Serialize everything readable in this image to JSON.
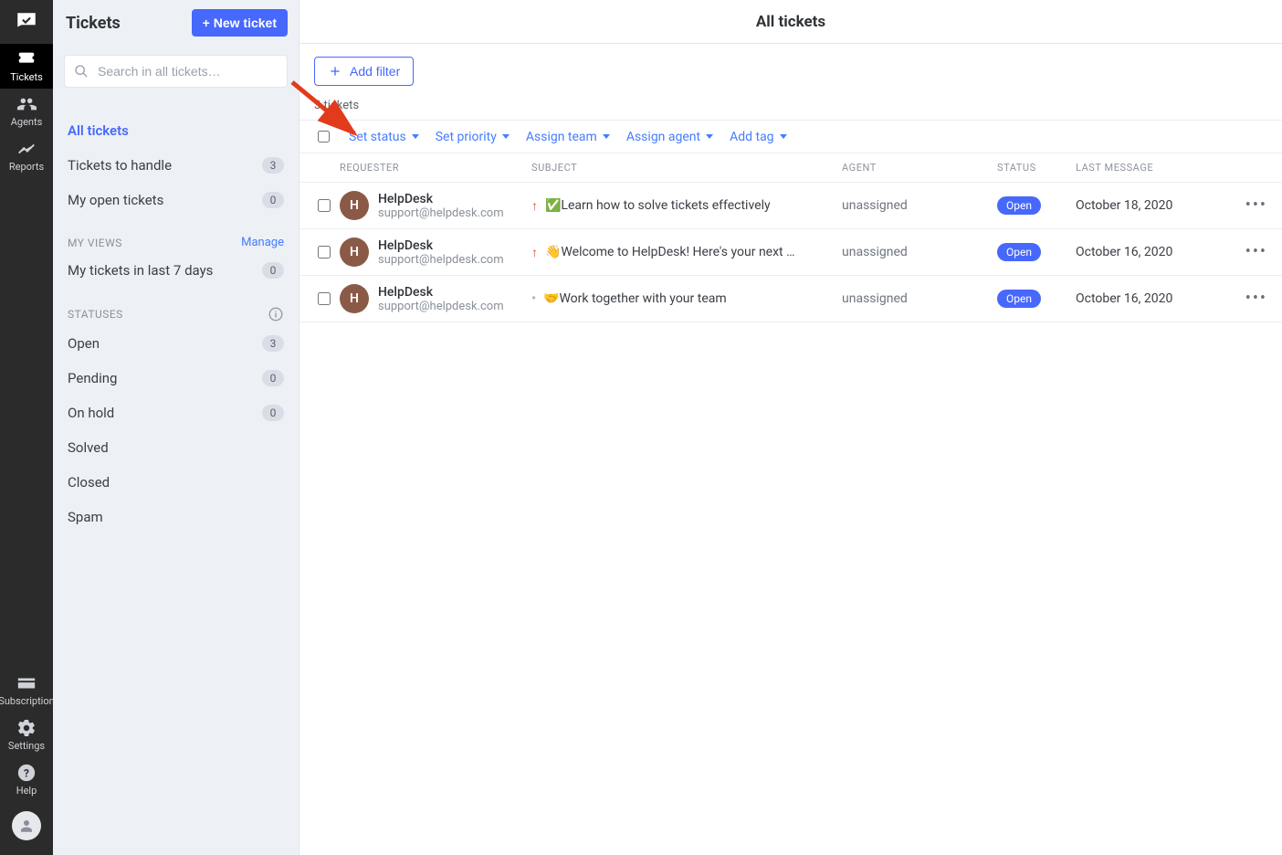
{
  "rail": {
    "items": [
      {
        "name": "tickets",
        "label": "Tickets",
        "active": true
      },
      {
        "name": "agents",
        "label": "Agents",
        "active": false
      },
      {
        "name": "reports",
        "label": "Reports",
        "active": false
      }
    ],
    "bottom": [
      {
        "name": "subscription",
        "label": "Subscription"
      },
      {
        "name": "settings",
        "label": "Settings"
      },
      {
        "name": "help",
        "label": "Help"
      }
    ]
  },
  "sidebar": {
    "title": "Tickets",
    "new_ticket": "+ New ticket",
    "search_placeholder": "Search in all tickets…",
    "nav": [
      {
        "label": "All tickets",
        "active": true,
        "badge": null
      },
      {
        "label": "Tickets to handle",
        "active": false,
        "badge": "3"
      },
      {
        "label": "My open tickets",
        "active": false,
        "badge": "0"
      }
    ],
    "my_views": {
      "header": "MY VIEWS",
      "manage": "Manage",
      "items": [
        {
          "label": "My tickets in last 7 days",
          "badge": "0"
        }
      ]
    },
    "statuses": {
      "header": "STATUSES",
      "items": [
        {
          "label": "Open",
          "badge": "3"
        },
        {
          "label": "Pending",
          "badge": "0"
        },
        {
          "label": "On hold",
          "badge": "0"
        },
        {
          "label": "Solved",
          "badge": null
        },
        {
          "label": "Closed",
          "badge": null
        },
        {
          "label": "Spam",
          "badge": null
        }
      ]
    }
  },
  "main": {
    "title": "All tickets",
    "add_filter": "Add filter",
    "count_text": "3 tickets",
    "bulk": [
      "Set status",
      "Set priority",
      "Assign team",
      "Assign agent",
      "Add tag"
    ],
    "columns": [
      "REQUESTER",
      "SUBJECT",
      "AGENT",
      "STATUS",
      "LAST MESSAGE"
    ],
    "rows": [
      {
        "avatar": "H",
        "name": "HelpDesk",
        "email": "support@helpdesk.com",
        "priority": "high",
        "subject": "✅Learn how to solve tickets effectively",
        "agent": "unassigned",
        "status": "Open",
        "date": "October 18, 2020"
      },
      {
        "avatar": "H",
        "name": "HelpDesk",
        "email": "support@helpdesk.com",
        "priority": "high",
        "subject": "👋Welcome to HelpDesk! Here's your next …",
        "agent": "unassigned",
        "status": "Open",
        "date": "October 16, 2020"
      },
      {
        "avatar": "H",
        "name": "HelpDesk",
        "email": "support@helpdesk.com",
        "priority": "low",
        "subject": "🤝Work together with your team",
        "agent": "unassigned",
        "status": "Open",
        "date": "October 16, 2020"
      }
    ]
  }
}
